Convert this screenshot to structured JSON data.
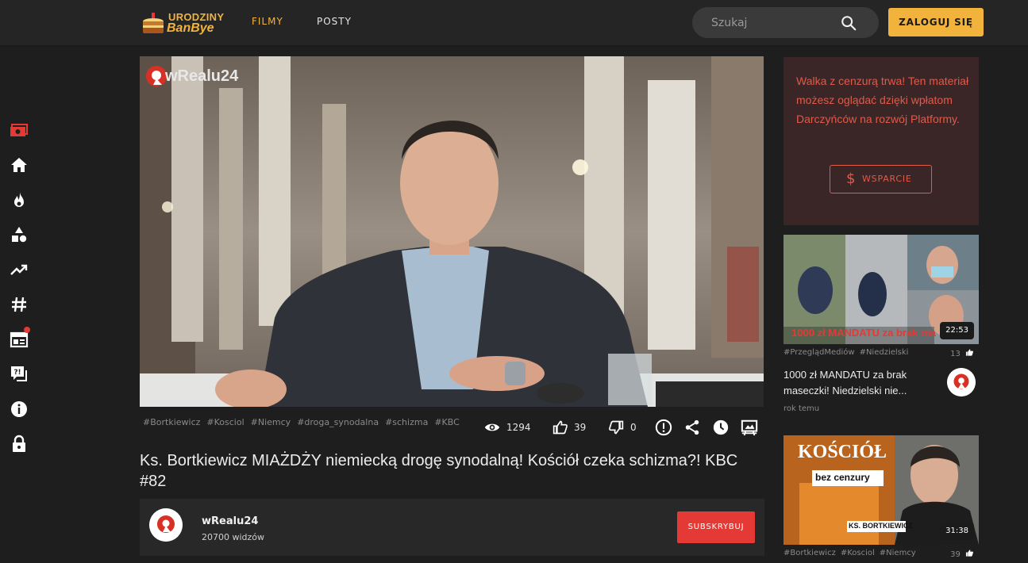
{
  "header": {
    "logo_line1": "URODZINY",
    "logo_line2": "BanBye",
    "nav": {
      "films": "FILMY",
      "posts": "POSTY"
    },
    "search_placeholder": "Szukaj",
    "login_label": "ZALOGUJ SIĘ"
  },
  "colors": {
    "accent": "#f2b33d",
    "red": "#e53935",
    "donate_bg": "#3a2626",
    "donate_text": "#e15a4a"
  },
  "sidebar": {
    "icons": [
      "money-icon",
      "home-icon",
      "fire-icon",
      "categories-icon",
      "trending-icon",
      "hashtag-icon",
      "news-icon",
      "forum-icon",
      "info-icon",
      "lock-icon"
    ]
  },
  "video": {
    "channel_logo": "wRealu24",
    "tags": [
      "#Bortkiewicz",
      "#Kosciol",
      "#Niemcy",
      "#droga_synodalna",
      "#schizma",
      "#KBC"
    ],
    "views": "1294",
    "likes": "39",
    "dislikes": "0",
    "title": "Ks. Bortkiewicz MIAŻDŻY niemiecką drogę synodalną! Kościół czeka schizma?! KBC #82"
  },
  "channel": {
    "name": "wRealu24",
    "views": "20700 widzów",
    "subscribe_label": "SUBSKRYBUJ"
  },
  "donate": {
    "text": "Walka z cenzurą trwa! Ten materiał możesz oglądać dzięki wpłatom Darczyńców na rozwój Platformy.",
    "button_label": "WSPARCIE",
    "button_symbol": "$"
  },
  "recommended": [
    {
      "duration": "22:53",
      "tags": [
        "#PrzeglądMediów",
        "#Niedzielski"
      ],
      "likes": "13",
      "title": "1000 zł MANDATU za brak maseczki! Niedzielski nie...",
      "time": "rok temu",
      "overlay_text": "1000 zł MANDATU za brak ma"
    },
    {
      "duration": "31:38",
      "tags": [
        "#Bortkiewicz",
        "#Kosciol",
        "#Niemcy"
      ],
      "likes": "39",
      "overlay_title": "KOŚCIÓŁ",
      "overlay_sub": "bez cenzury",
      "overlay_name": "KS. BORTKIEWICZ"
    }
  ]
}
